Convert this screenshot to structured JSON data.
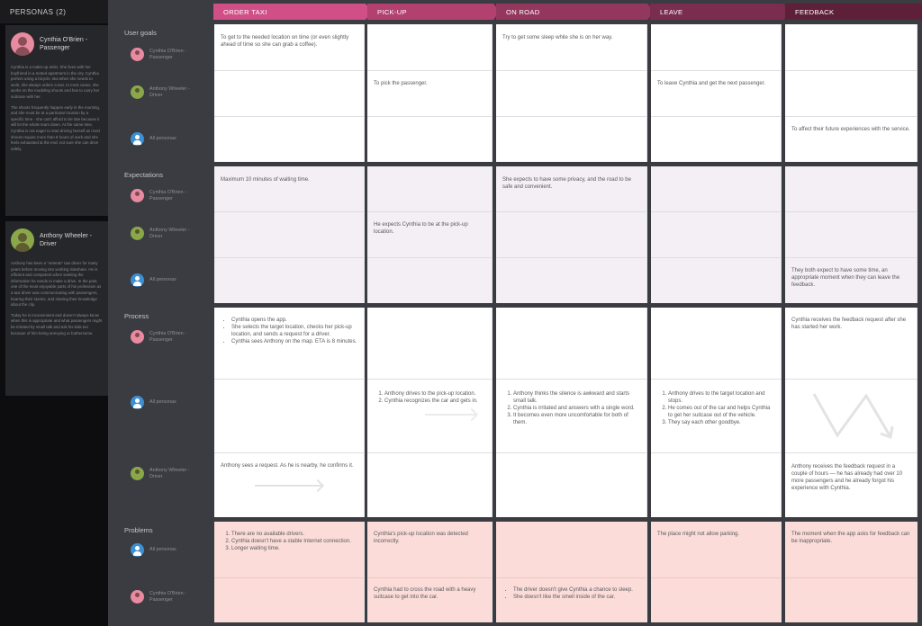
{
  "personas_panel": {
    "header": "PERSONAS (2)",
    "personas": [
      {
        "name": "Cynthia O'Brien - Passenger",
        "paragraphs": [
          "Cynthia is a make-up artist. She lives with her boyfriend in a rented apartment in the city. Cynthia prefers using a bicycle. But when she needs to work, she always orders a taxi. In most cases, she works on the modeling shoots and has to carry her suitcase with her.",
          "The shoots frequently happen early in the morning, and she must be at a particular location by a specific time - she can't afford to be late because it will let the whole team down. At the same time, Cynthia is not eager to start driving herself as most shoots require more than 8 hours of work and she feels exhausted at the end, not sure she can drive safely."
        ]
      },
      {
        "name": "Anthony Wheeler - Driver",
        "paragraphs": [
          "Anthony has been a \"veteran\" taxi driver for many years before moving into working rideshare. He is efficient and competent when seeking the information he needs to make a drive. In the past, one of the most enjoyable parts of his profession as a taxi driver was communicating with passengers, hearing their stories, and sharing their knowledge about the city.",
          "Today he is inconvenient and doesn't always know when this is appropriate and what passengers might be irritated by small talk and ask his kids too because of him being annoying or bothersome."
        ]
      }
    ]
  },
  "stages": [
    {
      "label": "ORDER TAXI",
      "color": "#cf4f86"
    },
    {
      "label": "PICK-UP",
      "color": "#b2416f"
    },
    {
      "label": "ON ROAD",
      "color": "#94375e"
    },
    {
      "label": "LEAVE",
      "color": "#7a2d4e"
    },
    {
      "label": "FEEDBACK",
      "color": "#5e2039"
    }
  ],
  "sections": {
    "user_goals": {
      "label": "User goals",
      "lanes": [
        "Cynthia O'Brien - Passenger",
        "Anthony Wheeler - Driver",
        "All personas"
      ],
      "cells": {
        "order_taxi": "To get to the needed location on time (or even slightly ahead of time so she can grab a coffee).",
        "pick_up": "To pick the passenger.",
        "on_road": "Try to get some sleep while she is on her way.",
        "leave": "To leave Cynthia and get the next passenger.",
        "feedback": "To affect their future experiences with the service."
      }
    },
    "expectations": {
      "label": "Expectations",
      "lanes": [
        "Cynthia O'Brien - Passenger",
        "Anthony Wheeler - Driver",
        "All personas"
      ],
      "cells": {
        "order_taxi": "Maximum 10 minutes of waiting time.",
        "pick_up": "He expects Cynthia to be at the pick-up location.",
        "on_road": "She expects to have some privacy, and the road to be safe and convenient.",
        "feedback": "They both expect to have some time, an appropriate moment when they can leave the feedback."
      }
    },
    "process": {
      "label": "Process",
      "lanes": [
        "Cynthia O'Brien - Passenger",
        "All personas",
        "Anthony Wheeler - Driver"
      ],
      "order_taxi_list": [
        "Cynthia opens the app.",
        "She selects the target location, checks her pick-up location, and sends a request for a driver.",
        "Cynthia sees Anthony on the map. ETA is 8 minutes."
      ],
      "order_taxi_driver": "Anthony sees a request. As he is nearby, he confirms it.",
      "pick_up_list": [
        "Anthony drives to the pick-up location.",
        "Cynthia recognizes the car and gets in."
      ],
      "on_road_list": [
        "Anthony thinks the silence is awkward and starts small talk.",
        "Cynthia is irritated and answers with a single word.",
        "It becomes even more uncomfortable for both of them."
      ],
      "leave_list": [
        "Anthony drives to the target location and stops.",
        "He comes out of the car and helps Cynthia to get her suitcase out of the vehicle.",
        "They say each other goodbye."
      ],
      "feedback_passenger": "Cynthia receives the feedback request after she has started her work.",
      "feedback_driver": "Anthony receives the feedback request in a couple of hours — he has already had over 10 more passengers and he already forgot his experience with Cynthia."
    },
    "problems": {
      "label": "Problems",
      "lanes": [
        "All personas",
        "Cynthia O'Brien - Passenger"
      ],
      "order_taxi_list": [
        "There are no available drivers.",
        "Cynthia doesn't have a stable Internet connection.",
        "Longer waiting time."
      ],
      "pick_up_top": "Cynthia's pick-up location was detected incorrectly.",
      "pick_up_bottom": "Cynthia had to cross the road with a heavy suitcase to get into the car.",
      "on_road_list": [
        "The driver doesn't give Cynthia a chance to sleep.",
        "She doesn't like the smell inside of the car."
      ],
      "leave": "The place might not allow parking.",
      "feedback": "The moment when the app asks for feedback can be inappropriate."
    }
  }
}
